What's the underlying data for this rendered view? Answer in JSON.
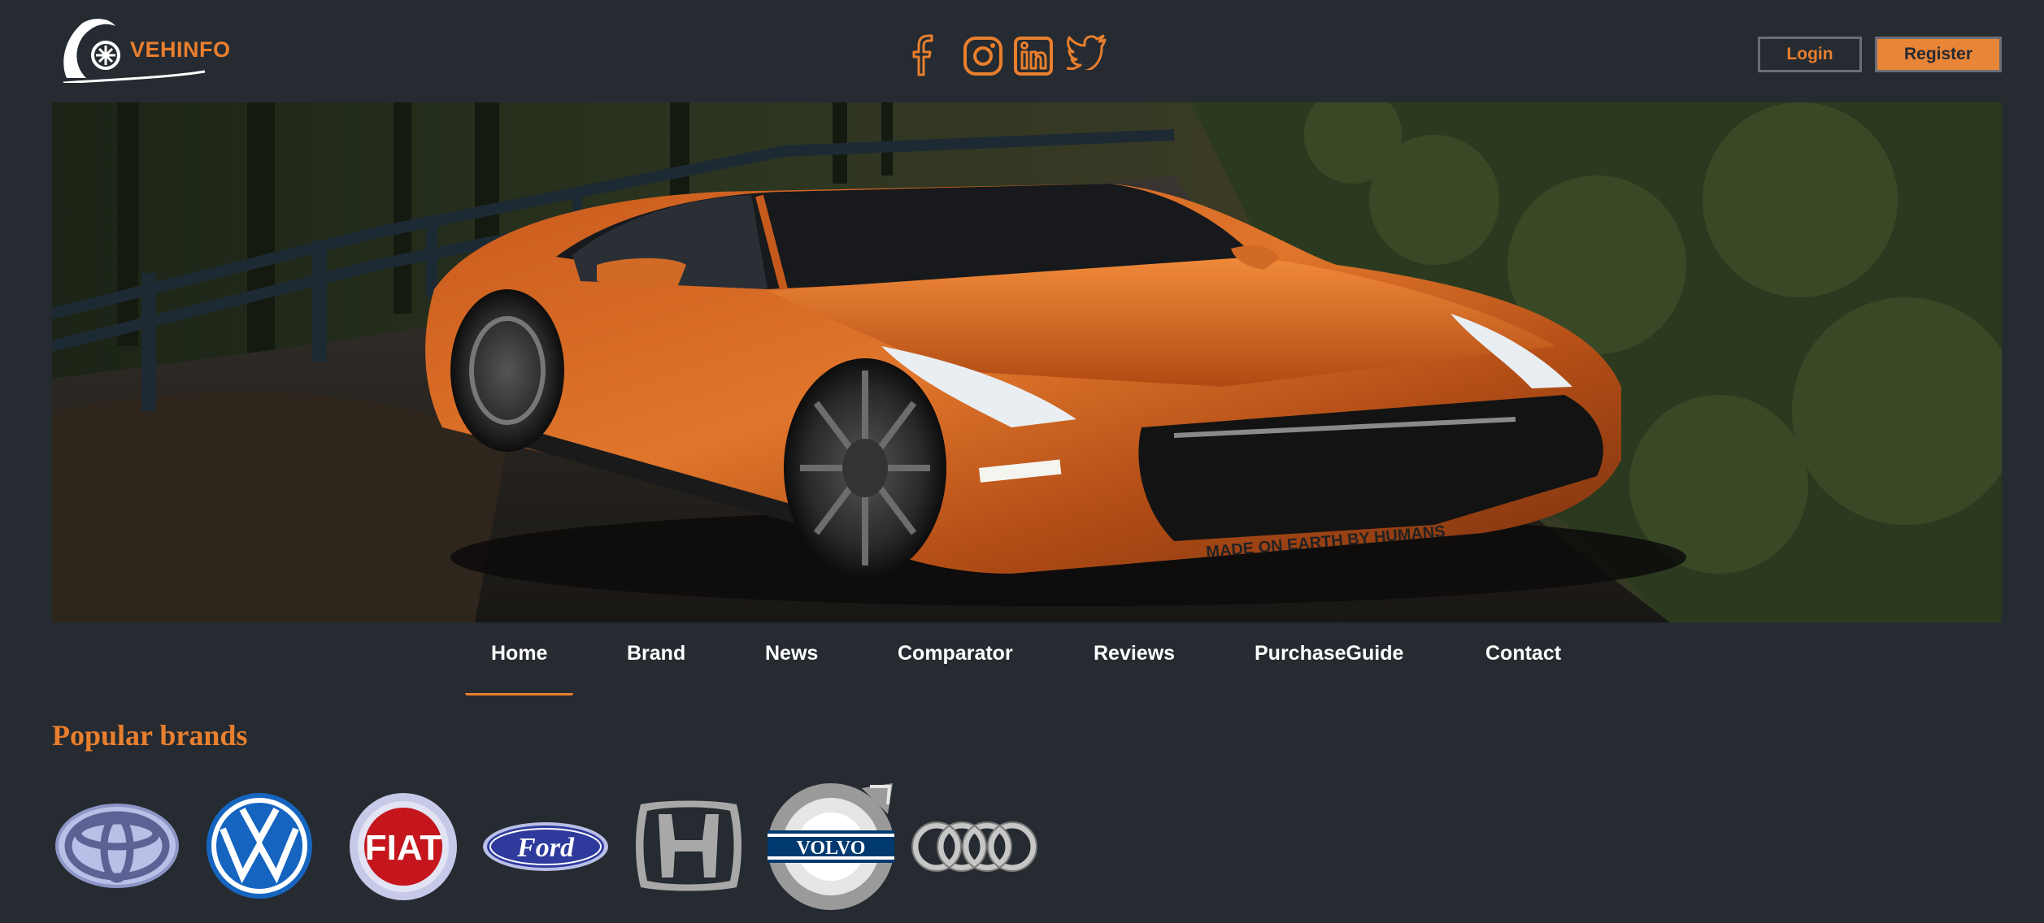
{
  "header": {
    "logo_text": "VEHINFO",
    "social": [
      "facebook-icon",
      "instagram-icon",
      "linkedin-icon",
      "twitter-icon"
    ],
    "login_label": "Login",
    "register_label": "Register"
  },
  "nav": {
    "items": [
      "Home",
      "Brand",
      "News",
      "Comparator",
      "Reviews",
      "PurchaseGuide",
      "Contact"
    ],
    "active": "Home"
  },
  "hero": {
    "plate_text": "MADE ON EARTH BY HUMANS"
  },
  "brands": {
    "title": "Popular brands",
    "items": [
      {
        "name": "toyota-logo"
      },
      {
        "name": "volkswagen-logo"
      },
      {
        "name": "fiat-logo",
        "text": "FIAT"
      },
      {
        "name": "ford-logo",
        "text": "Ford"
      },
      {
        "name": "honda-logo"
      },
      {
        "name": "volvo-logo",
        "text": "VOLVO"
      },
      {
        "name": "audi-logo"
      }
    ]
  },
  "colors": {
    "background": "#262b31",
    "accent": "#e97f2e",
    "text": "#ffffff",
    "button_border": "#6b6f75"
  }
}
